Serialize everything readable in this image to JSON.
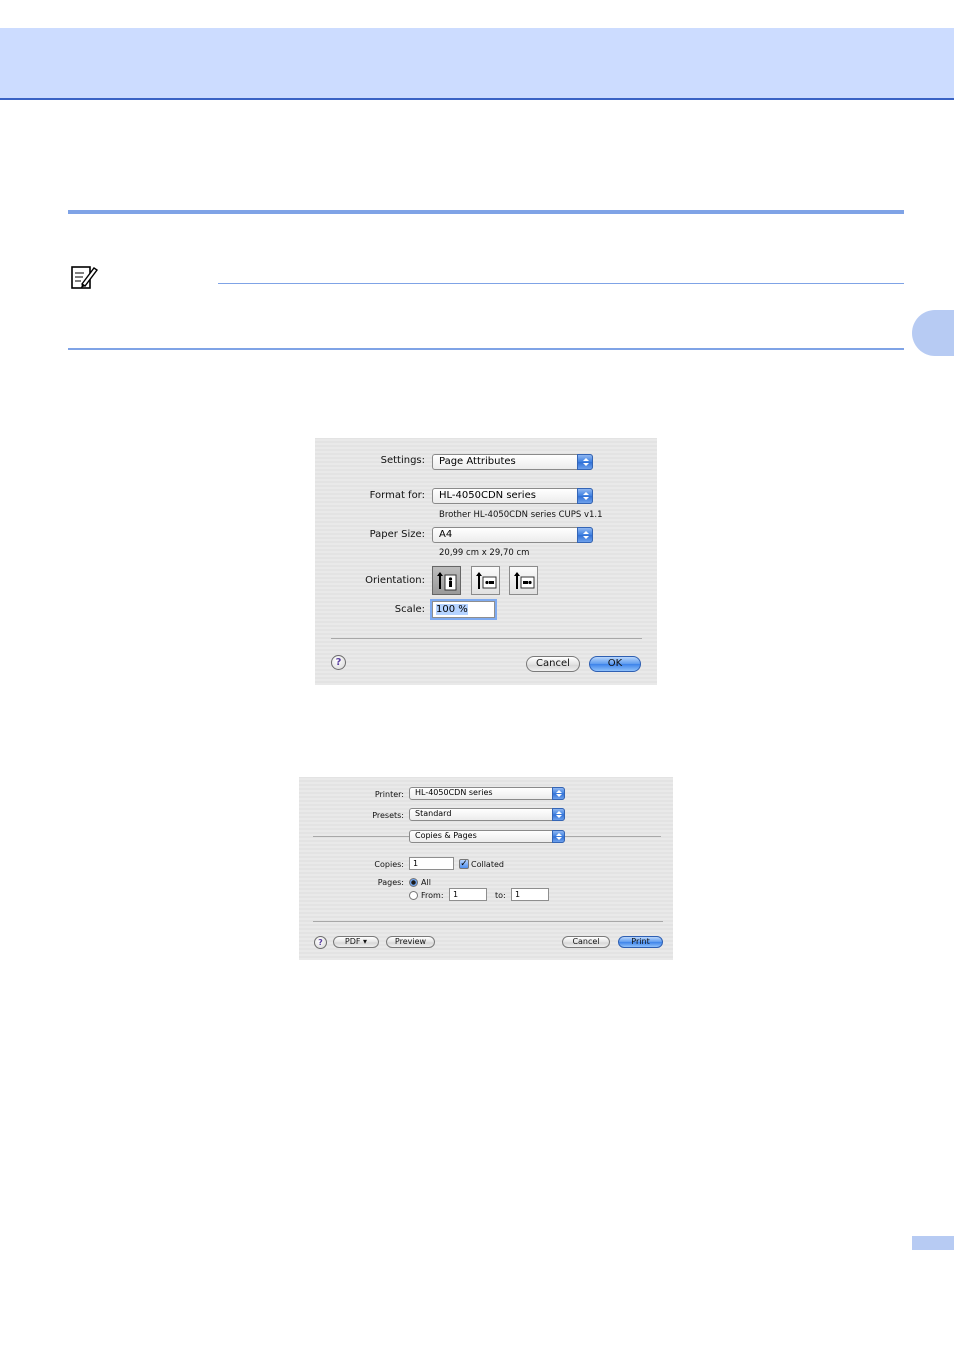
{
  "page_setup_dialog": {
    "settings_label": "Settings:",
    "settings_value": "Page Attributes",
    "format_for_label": "Format for:",
    "format_for_value": "HL-4050CDN series",
    "format_for_description": "Brother HL-4050CDN series CUPS v1.1",
    "paper_size_label": "Paper Size:",
    "paper_size_value": "A4",
    "paper_size_description": "20,99 cm x 29,70 cm",
    "orientation_label": "Orientation:",
    "orientation_options": [
      "portrait",
      "landscape",
      "reverse-landscape"
    ],
    "orientation_selected": "portrait",
    "scale_label": "Scale:",
    "scale_value": "100 %",
    "help_label": "?",
    "cancel_label": "Cancel",
    "ok_label": "OK"
  },
  "print_dialog": {
    "printer_label": "Printer:",
    "printer_value": "HL-4050CDN series",
    "presets_label": "Presets:",
    "presets_value": "Standard",
    "panel_value": "Copies & Pages",
    "copies_label": "Copies:",
    "copies_value": "1",
    "collated_label": "Collated",
    "collated_checked": true,
    "pages_label": "Pages:",
    "pages_all_label": "All",
    "pages_from_label": "From:",
    "pages_from_value": "1",
    "pages_to_label": "to:",
    "pages_to_value": "1",
    "pages_selected": "All",
    "help_label": "?",
    "pdf_label": "PDF ▾",
    "preview_label": "Preview",
    "cancel_label": "Cancel",
    "print_label": "Print"
  },
  "colors": {
    "header_band": "#ccdcff",
    "header_rule": "#3a63c4",
    "section_rule": "#7fa3e6",
    "accent_button": "#3d83ea"
  }
}
